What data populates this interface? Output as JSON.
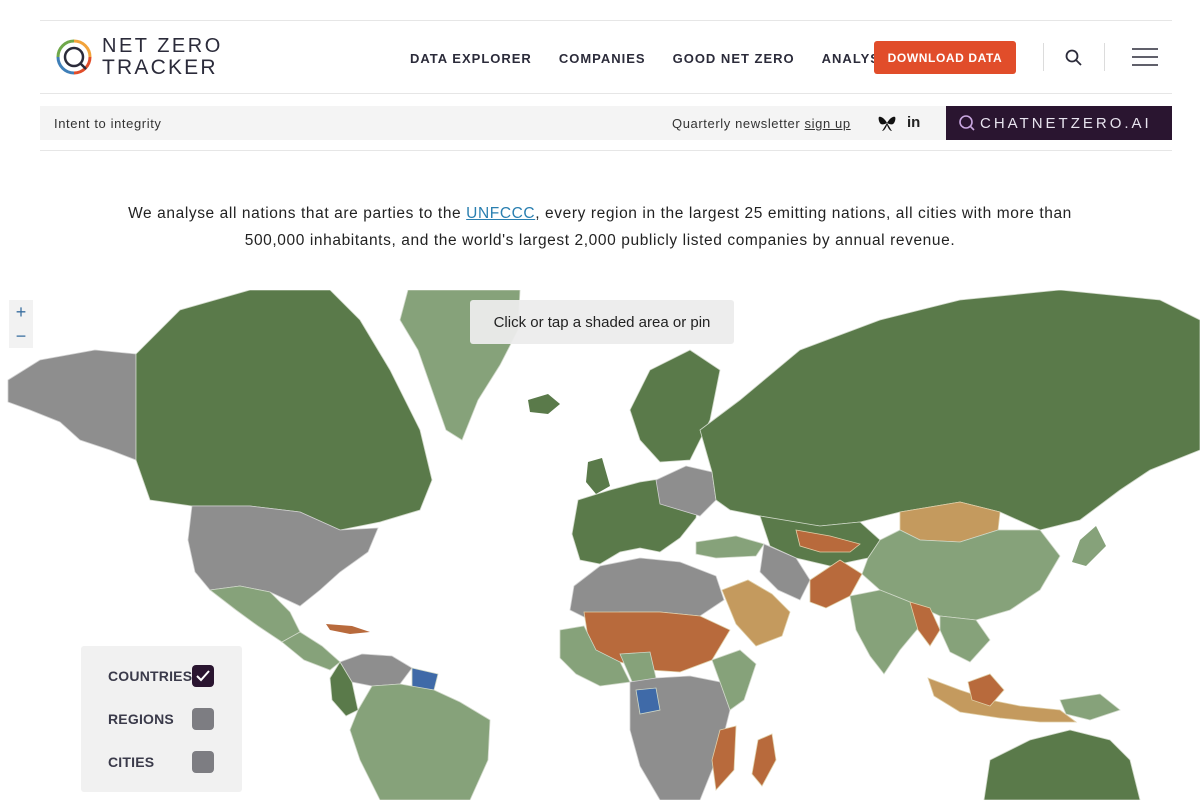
{
  "brand": {
    "line1": "NET ZERO",
    "line2": "TRACKER"
  },
  "nav": {
    "items": [
      "DATA EXPLORER",
      "COMPANIES",
      "GOOD NET ZERO",
      "ANALYSIS"
    ],
    "download_label": "DOWNLOAD DATA"
  },
  "subbar": {
    "tagline": "Intent to integrity",
    "newsletter_text": "Quarterly newsletter",
    "newsletter_link": "sign up",
    "linkedin": "in",
    "chat_banner": "CHATNETZERO.AI"
  },
  "intro": {
    "before_link": "We analyse all nations that are parties to the ",
    "link": "UNFCCC",
    "after_link": ", every region in the largest 25 emitting nations, all cities with more than 500,000 inhabitants, and the world's largest 2,000 publicly listed companies by annual revenue."
  },
  "map": {
    "tooltip": "Click or tap a shaded area or pin",
    "zoom_in": "+",
    "zoom_out": "−",
    "colors": {
      "ocean": "#ffffff",
      "dark_green": "#5a7a4a",
      "mid_green": "#86a27a",
      "grey": "#8e8e8e",
      "orange": "#b86a3c",
      "tan": "#c49a5e",
      "blue": "#3f6aa8"
    }
  },
  "legend": {
    "items": [
      {
        "label": "COUNTRIES",
        "checked": true
      },
      {
        "label": "REGIONS",
        "checked": false
      },
      {
        "label": "CITIES",
        "checked": false
      }
    ]
  }
}
